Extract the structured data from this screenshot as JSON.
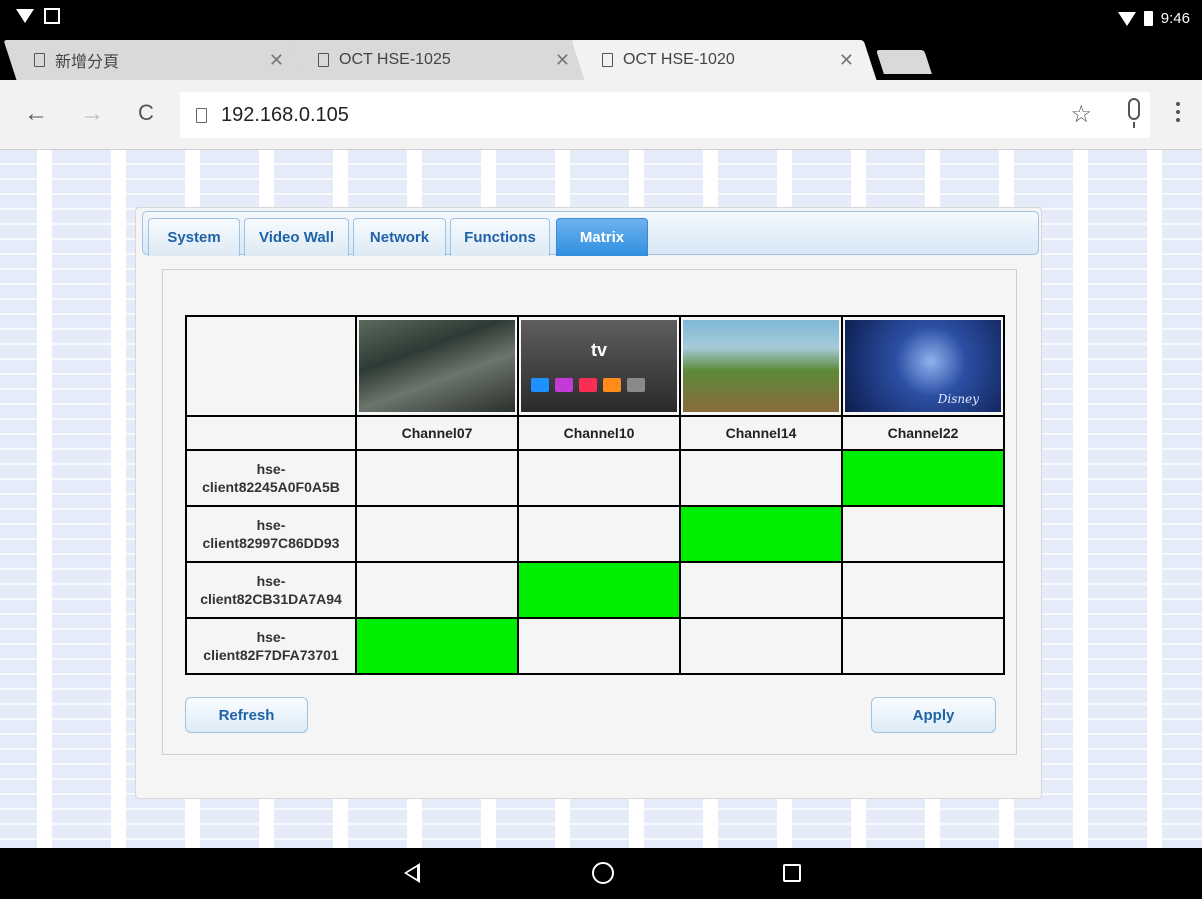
{
  "status_bar": {
    "time": "9:46"
  },
  "browser": {
    "tabs": [
      {
        "title": "新增分頁",
        "active": false
      },
      {
        "title": "OCT HSE-1025",
        "active": false
      },
      {
        "title": "OCT HSE-1020",
        "active": true
      }
    ],
    "tab_close_glyph": "✕",
    "address": "192.168.0.105",
    "icons": {
      "back": "←",
      "forward": "→",
      "reload": "C",
      "bookmark": "☆"
    }
  },
  "panel": {
    "tabs": [
      {
        "label": "System"
      },
      {
        "label": "Video Wall"
      },
      {
        "label": "Network"
      },
      {
        "label": "Functions"
      },
      {
        "label": "Matrix",
        "active": true
      }
    ],
    "matrix": {
      "channels": [
        "Channel07",
        "Channel10",
        "Channel14",
        "Channel22"
      ],
      "thumbnails": {
        "apple_tv_logo": "tv",
        "disney_text": "Disney"
      },
      "clients": [
        {
          "line1": "hse-",
          "line2": "client82245A0F0A5B",
          "assigned": 3
        },
        {
          "line1": "hse-",
          "line2": "client82997C86DD93",
          "assigned": 2
        },
        {
          "line1": "hse-",
          "line2": "client82CB31DA7A94",
          "assigned": 1
        },
        {
          "line1": "hse-",
          "line2": "client82F7DFA73701",
          "assigned": 0
        }
      ],
      "active_color": "#00ee00"
    },
    "buttons": {
      "refresh": "Refresh",
      "apply": "Apply"
    }
  }
}
